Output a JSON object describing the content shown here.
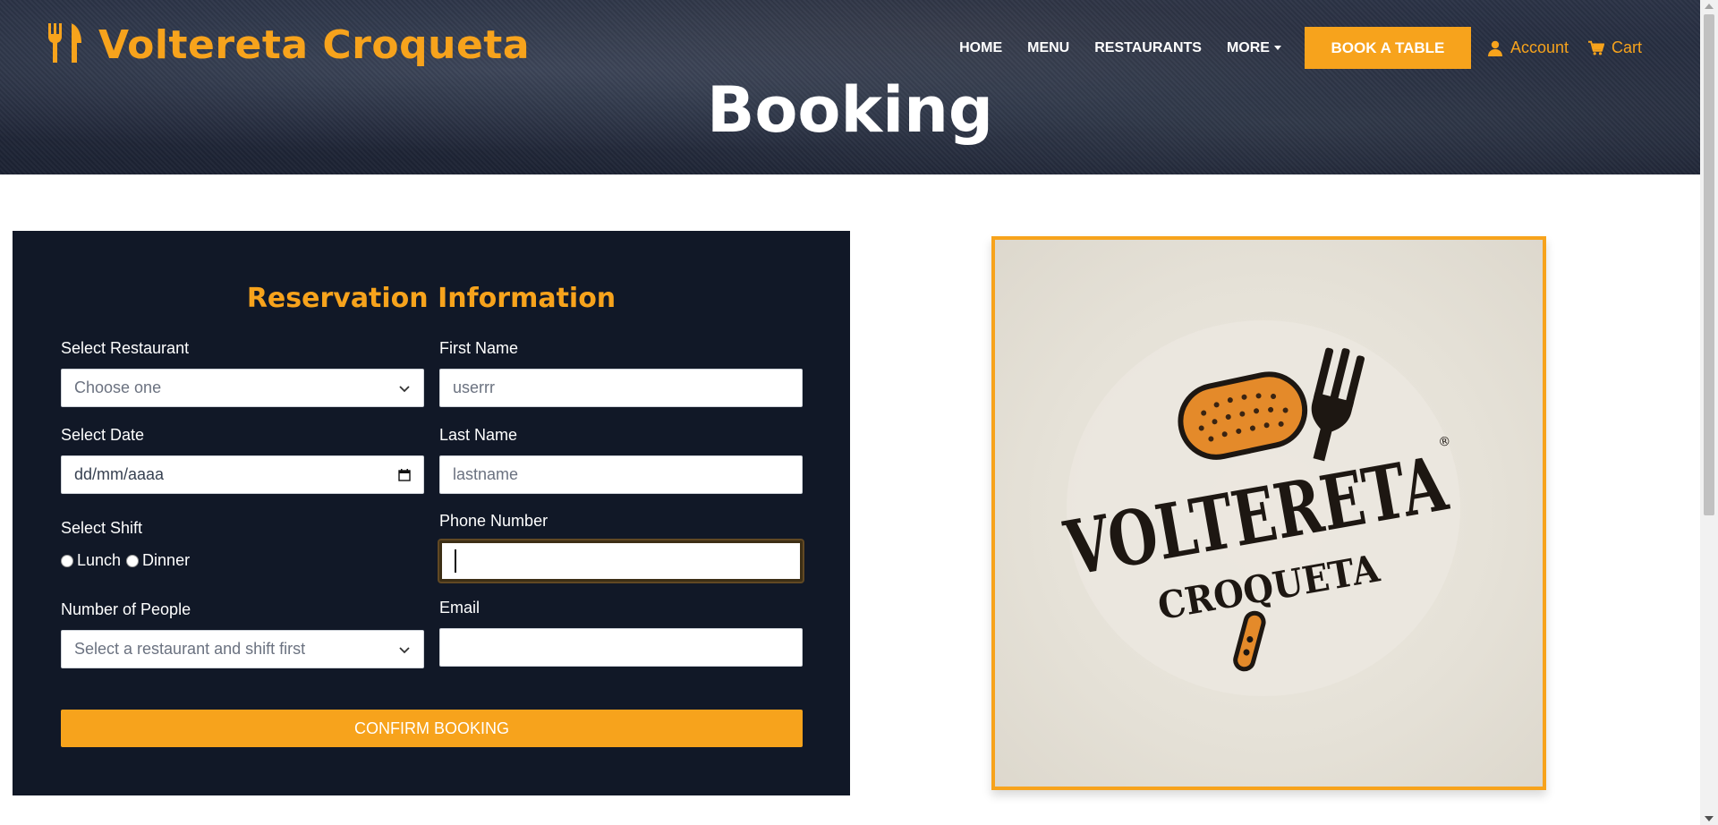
{
  "brand": {
    "name": "Voltereta Croqueta",
    "icon": "fork-knife-icon"
  },
  "nav": {
    "home": "HOME",
    "menu": "MENU",
    "restaurants": "RESTAURANTS",
    "more": "MORE",
    "book": "BOOK A TABLE",
    "account": "Account",
    "cart": "Cart"
  },
  "hero": {
    "title": "Booking"
  },
  "form": {
    "title": "Reservation Information",
    "restaurant": {
      "label": "Select Restaurant",
      "value": "Choose one"
    },
    "date": {
      "label": "Select Date",
      "placeholder": "dd/mm/aaaa"
    },
    "shift": {
      "label": "Select Shift",
      "options": [
        "Lunch",
        "Dinner"
      ]
    },
    "people": {
      "label": "Number of People",
      "value": "Select a restaurant and shift first"
    },
    "first_name": {
      "label": "First Name",
      "value": "userrr"
    },
    "last_name": {
      "label": "Last Name",
      "value": "lastname"
    },
    "phone": {
      "label": "Phone Number",
      "value": ""
    },
    "email": {
      "label": "Email",
      "value": ""
    },
    "submit": "CONFIRM BOOKING"
  },
  "logo_image": {
    "line1": "VOLTERETA",
    "line2": "CROQUETA",
    "mark": "®"
  },
  "colors": {
    "accent": "#f7a31c",
    "panel": "#111827",
    "header": "#1c2233"
  }
}
